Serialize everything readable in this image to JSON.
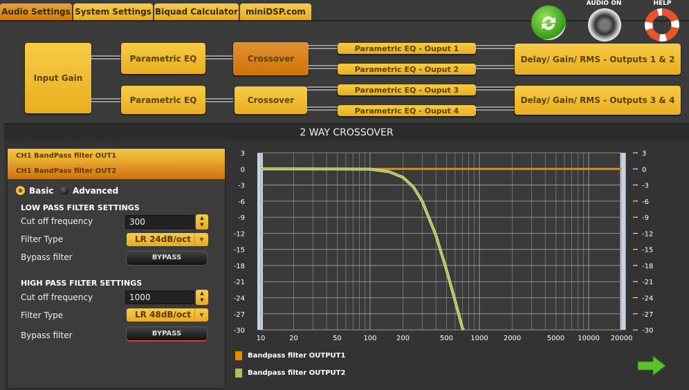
{
  "tabs": [
    {
      "label": "Audio Settings",
      "active": true
    },
    {
      "label": "System Settings"
    },
    {
      "label": "Biquad Calculator"
    },
    {
      "label": "miniDSP.com"
    }
  ],
  "icons": {
    "refresh": "refresh-icon",
    "audio_label": "AUDIO ON",
    "help_label": "HELP"
  },
  "diagram": {
    "input_gain": "Input Gain",
    "peq1": "Parametric EQ",
    "peq2": "Parametric EQ",
    "xo1": "Crossover",
    "xo2": "Crossover",
    "out_peq": [
      "Parametric EQ - Ouput 1",
      "Parametric EQ - Ouput 2",
      "Parametric EQ - Ouput 3",
      "Parametric EQ - Ouput 4"
    ],
    "dg12": "Delay/ Gain/ RMS - Outputs 1 & 2",
    "dg34": "Delay/ Gain/ RMS - Outputs 3 & 4"
  },
  "panel": {
    "title": "2 WAY CROSSOVER",
    "channels": [
      "CH1 BandPass filter OUT1",
      "CH1 BandPass filter OUT2"
    ],
    "mode": {
      "basic": "Basic",
      "advanced": "Advanced",
      "selected": "Basic"
    },
    "lowpass": {
      "header": "LOW PASS FILTER SETTINGS",
      "cutoff_label": "Cut off frequency",
      "cutoff": "300",
      "type_label": "Filter Type",
      "type": "LR 24dB/oct",
      "bypass_label": "Bypass filter",
      "bypass_button": "BYPASS"
    },
    "highpass": {
      "header": "HIGH PASS FILTER SETTINGS",
      "cutoff_label": "Cut off frequency",
      "cutoff": "1000",
      "type_label": "Filter Type",
      "type": "LR 48dB/oct",
      "bypass_label": "Bypass filter",
      "bypass_button": "BYPASS"
    }
  },
  "chart_data": {
    "type": "line",
    "xscale": "log",
    "xlim": [
      10,
      20000
    ],
    "ylim": [
      -30,
      3
    ],
    "xticks": [
      10,
      20,
      50,
      100,
      200,
      500,
      1000,
      2000,
      5000,
      10000,
      20000
    ],
    "yticks": [
      3,
      0,
      -3,
      -6,
      -9,
      -12,
      -15,
      -18,
      -21,
      -24,
      -27,
      -30
    ],
    "series": [
      {
        "name": "Bandpass filter OUTPUT1",
        "color": "#e68a00",
        "x": [
          10,
          20000
        ],
        "y": [
          0,
          0
        ]
      },
      {
        "name": "Bandpass filter OUTPUT2",
        "color": "#a8c45a",
        "x": [
          10,
          20,
          50,
          100,
          150,
          200,
          250,
          300,
          400,
          500,
          600,
          700,
          720
        ],
        "y": [
          0,
          0,
          -0.01,
          -0.05,
          -0.53,
          -1.57,
          -3.42,
          -6.02,
          -12.38,
          -18.81,
          -24.6,
          -29.7,
          -30
        ]
      }
    ],
    "legend": "bottom-left"
  }
}
